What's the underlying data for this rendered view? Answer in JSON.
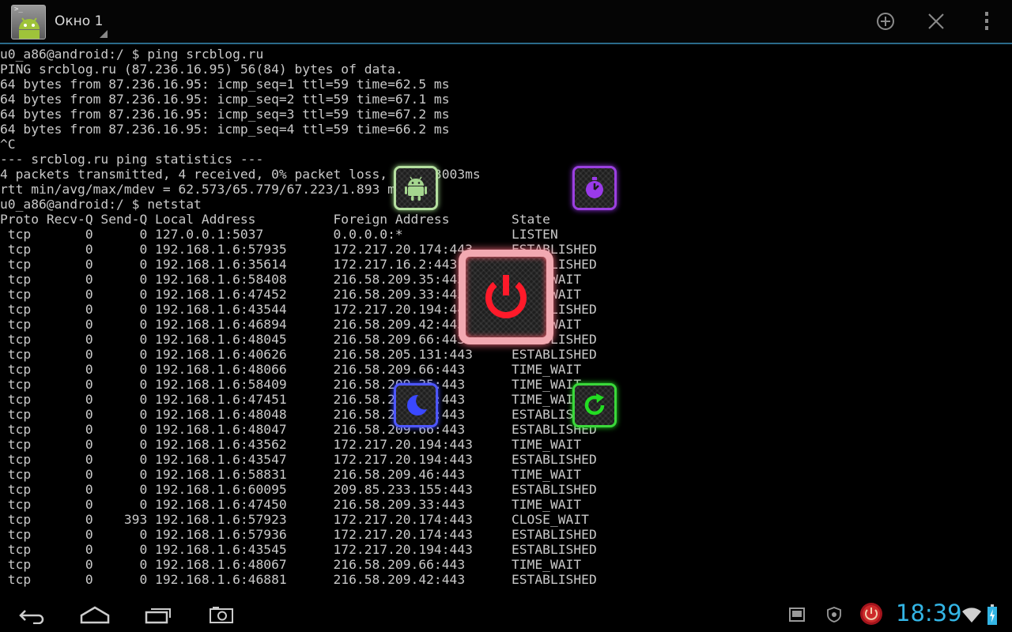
{
  "app": {
    "window_title": "Окно 1",
    "icon_prompt": ">_",
    "actions": {
      "new_window": "plus-circle-icon",
      "close_window": "close-icon",
      "overflow_menu": "more-vert-icon"
    }
  },
  "terminal": {
    "lines": [
      "u0_a86@android:/ $ ping srcblog.ru",
      "PING srcblog.ru (87.236.16.95) 56(84) bytes of data.",
      "64 bytes from 87.236.16.95: icmp_seq=1 ttl=59 time=62.5 ms",
      "64 bytes from 87.236.16.95: icmp_seq=2 ttl=59 time=67.1 ms",
      "64 bytes from 87.236.16.95: icmp_seq=3 ttl=59 time=67.2 ms",
      "64 bytes from 87.236.16.95: icmp_seq=4 ttl=59 time=66.2 ms",
      "^C",
      "--- srcblog.ru ping statistics ---",
      "4 packets transmitted, 4 received, 0% packet loss, time 3003ms",
      "rtt min/avg/max/mdev = 62.573/65.779/67.223/1.893 ms",
      "u0_a86@android:/ $ netstat",
      "Proto Recv-Q Send-Q Local Address          Foreign Address        State",
      " tcp       0      0 127.0.0.1:5037         0.0.0.0:*              LISTEN",
      " tcp       0      0 192.168.1.6:57935      172.217.20.174:443     ESTABLISHED",
      " tcp       0      0 192.168.1.6:35614      172.217.16.2:443       ESTABLISHED",
      " tcp       0      0 192.168.1.6:58408      216.58.209.35:443      TIME_WAIT",
      " tcp       0      0 192.168.1.6:47452      216.58.209.33:443      TIME_WAIT",
      " tcp       0      0 192.168.1.6:43544      172.217.20.194:443     ESTABLISHED",
      " tcp       0      0 192.168.1.6:46894      216.58.209.42:443      TIME_WAIT",
      " tcp       0      0 192.168.1.6:48045      216.58.209.66:443      ESTABLISHED",
      " tcp       0      0 192.168.1.6:40626      216.58.205.131:443     ESTABLISHED",
      " tcp       0      0 192.168.1.6:48066      216.58.209.66:443      TIME_WAIT",
      " tcp       0      0 192.168.1.6:58409      216.58.209.35:443      TIME_WAIT",
      " tcp       0      0 192.168.1.6:47451      216.58.209.33:443      TIME_WAIT",
      " tcp       0      0 192.168.1.6:48048      216.58.209.66:443      ESTABLISHED",
      " tcp       0      0 192.168.1.6:48047      216.58.209.66:443      ESTABLISHED",
      " tcp       0      0 192.168.1.6:43562      172.217.20.194:443     TIME_WAIT",
      " tcp       0      0 192.168.1.6:43547      172.217.20.194:443     ESTABLISHED",
      " tcp       0      0 192.168.1.6:58831      216.58.209.46:443      TIME_WAIT",
      " tcp       0      0 192.168.1.6:60095      209.85.233.155:443     ESTABLISHED",
      " tcp       0      0 192.168.1.6:47450      216.58.209.33:443      TIME_WAIT",
      " tcp       0    393 192.168.1.6:57923      172.217.20.174:443     CLOSE_WAIT",
      " tcp       0      0 192.168.1.6:57936      172.217.20.174:443     ESTABLISHED",
      " tcp       0      0 192.168.1.6:43545      172.217.20.194:443     ESTABLISHED",
      " tcp       0      0 192.168.1.6:48067      216.58.209.66:443      TIME_WAIT",
      " tcp       0      0 192.168.1.6:46881      216.58.209.42:443      ESTABLISHED"
    ]
  },
  "widgets": {
    "android": {
      "icon": "android-icon",
      "color": "#9fd88a"
    },
    "clock": {
      "icon": "stopwatch-icon",
      "color": "#9030e0"
    },
    "power": {
      "icon": "power-icon",
      "color": "#ff1a2a"
    },
    "sleep": {
      "icon": "moon-icon",
      "color": "#3a48ff"
    },
    "reboot": {
      "icon": "refresh-icon",
      "color": "#22dd22"
    }
  },
  "system_bar": {
    "clock": "18:39",
    "clock_color": "#33b5e5",
    "nav": [
      "back-icon",
      "home-icon",
      "recent-apps-icon",
      "screenshot-icon"
    ],
    "status_icons": [
      "notification-icon",
      "shield-icon",
      "power-app-icon",
      "wifi-icon",
      "battery-icon"
    ]
  }
}
